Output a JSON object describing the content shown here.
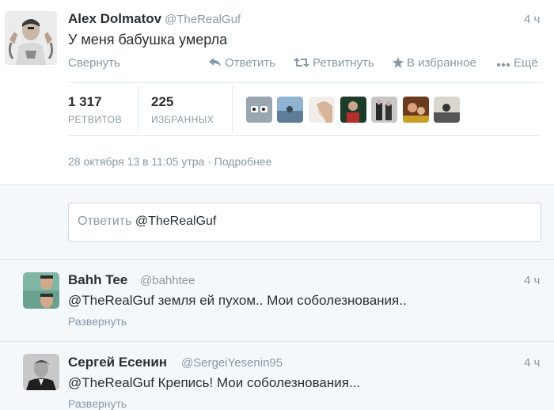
{
  "main_tweet": {
    "name": "Alex Dolmatov",
    "handle": "@TheRealGuf",
    "time": "4 ч",
    "text": "У меня бабушка умерла",
    "actions": {
      "collapse": "Свернуть",
      "reply": "Ответить",
      "retweet": "Ретвитнуть",
      "favorite": "В избранное",
      "more": "Ещё"
    },
    "stats": {
      "retweets_count": "1 317",
      "retweets_label": "РЕТВИТОВ",
      "favorites_count": "225",
      "favorites_label": "ИЗБРАННЫХ"
    },
    "date": "28 октября 13 в 11:05 утра",
    "date_sep": " · ",
    "details_link": "Подробнее"
  },
  "reply_box": {
    "placeholder": "Ответить ",
    "mention": "@TheRealGuf"
  },
  "replies": [
    {
      "name": "Bahh Tee",
      "handle": "@bahhtee",
      "time": "4 ч",
      "text": "@TheRealGuf земля ей пухом.. Мои соболезнования..",
      "expand": "Развернуть"
    },
    {
      "name": "Сергей Есенин",
      "handle": "@SergeiYesenin95",
      "time": "4 ч",
      "text": "@TheRealGuf Крепись! Мои соболезнования...",
      "expand": "Развернуть"
    }
  ],
  "colors": {
    "text": "#292f33",
    "muted": "#8899a6",
    "border": "#e1e8ed",
    "panel": "#f5f8fa"
  },
  "icons": {
    "reply": "reply-arrow-icon",
    "retweet": "retweet-icon",
    "favorite": "star-icon",
    "more": "dots-icon"
  }
}
